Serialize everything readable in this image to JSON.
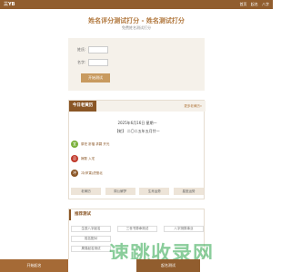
{
  "header": {
    "logo": "三YB",
    "nav": [
      "首页",
      "起名",
      "八字"
    ]
  },
  "page": {
    "title": "姓名评分测试打分 - 姓名测试打分",
    "subtitle": "免费姓名测试打分"
  },
  "form": {
    "surname_label": "姓氏:",
    "name_label": "名字:",
    "surname_value": "",
    "name_value": "",
    "submit_label": "开始测试"
  },
  "almanac": {
    "tab_label": "今日老黄历",
    "more_label": "更多老黄历»",
    "date_line1": "2025年6月16日 星期一",
    "date_line2": "【蛇】 二〇二五年五月廿一",
    "items": [
      {
        "icon": "宜",
        "text": "祭祀 祈福 求嗣 开光"
      },
      {
        "icon": "忌",
        "text": "嫁娶 入宅"
      },
      {
        "icon": "冲",
        "text": "冲(甲寅)虎煞北"
      }
    ],
    "buttons": [
      "老黄历",
      "周公解梦",
      "生肖运势",
      "星座运势"
    ]
  },
  "recommend": {
    "title": "推荐测试",
    "rows": [
      [
        "生辰八字起名",
        "三世书算命测试",
        "八字测算事业"
      ],
      [
        "姓名配对",
        "",
        ""
      ],
      [
        "周易起名测试",
        "",
        ""
      ]
    ]
  },
  "footer": {
    "left_label": "开始起名",
    "right_label": "起名测试"
  },
  "watermark": "速跳收录网"
}
